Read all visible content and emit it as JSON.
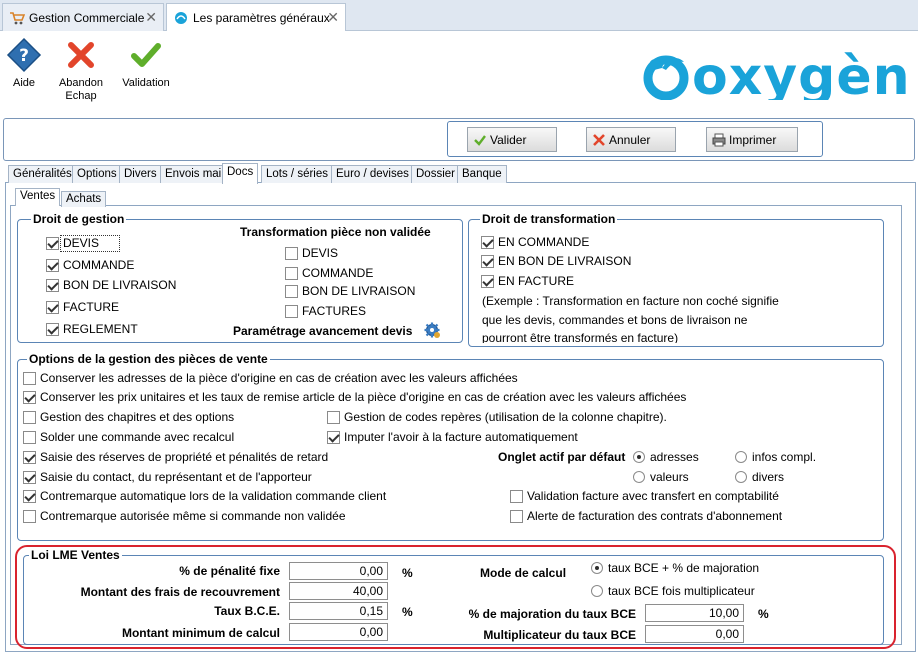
{
  "doc_tabs": [
    {
      "label": "Gestion Commerciale",
      "active": false
    },
    {
      "label": "Les paramètres généraux",
      "active": true
    }
  ],
  "toolbar": {
    "aide": "Aide",
    "abandon_line1": "Abandon",
    "abandon_line2": "Echap",
    "validation": "Validation"
  },
  "logo_text": "oxygène",
  "actions": {
    "valider": "Valider",
    "annuler": "Annuler",
    "imprimer": "Imprimer"
  },
  "settings_tabs": [
    "Généralités",
    "Options",
    "Divers",
    "Envois mail",
    "Docs",
    "Lots / séries",
    "Euro / devises",
    "Dossier",
    "Banque"
  ],
  "sub_tabs": [
    "Ventes",
    "Achats"
  ],
  "droit_gestion": {
    "title": "Droit de gestion",
    "items": [
      {
        "label": "DEVIS",
        "checked": true
      },
      {
        "label": "COMMANDE",
        "checked": true
      },
      {
        "label": "BON DE LIVRAISON",
        "checked": true
      },
      {
        "label": "FACTURE",
        "checked": true
      },
      {
        "label": "REGLEMENT",
        "checked": true
      }
    ],
    "transfo_title": "Transformation pièce non validée",
    "transfo_items": [
      {
        "label": "DEVIS",
        "checked": false
      },
      {
        "label": "COMMANDE",
        "checked": false
      },
      {
        "label": "BON DE LIVRAISON",
        "checked": false
      },
      {
        "label": "FACTURES",
        "checked": false
      }
    ],
    "avancement": "Paramétrage avancement devis"
  },
  "droit_transformation": {
    "title": "Droit de transformation",
    "items": [
      {
        "label": "EN COMMANDE",
        "checked": true
      },
      {
        "label": "EN BON DE LIVRAISON",
        "checked": true
      },
      {
        "label": "EN FACTURE",
        "checked": true
      }
    ],
    "note1": "(Exemple : Transformation en facture non coché signifie",
    "note2": "que les devis, commandes et bons de livraison ne",
    "note3": "pourront être transformés en facture)"
  },
  "options": {
    "title": "Options de la gestion des pièces de vente",
    "o1": {
      "label": "Conserver les adresses de la pièce d'origine en cas de création avec les valeurs affichées",
      "checked": false
    },
    "o2": {
      "label": "Conserver les prix unitaires et les taux de remise article de la pièce d'origine en cas de création avec les valeurs affichées",
      "checked": true
    },
    "o3": {
      "label": "Gestion des chapitres et des options",
      "checked": false
    },
    "o4": {
      "label": "Gestion de codes repères (utilisation de la colonne chapitre).",
      "checked": false
    },
    "o5": {
      "label": "Solder une commande avec recalcul",
      "checked": false
    },
    "o6": {
      "label": "Imputer l'avoir à la facture automatiquement",
      "checked": true
    },
    "o7": {
      "label": "Saisie des réserves de propriété et pénalités de retard",
      "checked": true
    },
    "o8": {
      "label": "Saisie du contact, du représentant et de l'apporteur",
      "checked": true
    },
    "o9": {
      "label": "Contremarque automatique lors de la validation commande client",
      "checked": true
    },
    "o10": {
      "label": "Contremarque autorisée même si commande non validée",
      "checked": false
    },
    "o11": {
      "label": "Validation facture avec transfert en comptabilité",
      "checked": false
    },
    "o12": {
      "label": "Alerte de facturation des contrats d'abonnement",
      "checked": false
    },
    "onglet_label": "Onglet actif par défaut",
    "onglet": [
      {
        "label": "adresses",
        "selected": true
      },
      {
        "label": "infos compl.",
        "selected": false
      },
      {
        "label": "valeurs",
        "selected": false
      },
      {
        "label": "divers",
        "selected": false
      }
    ]
  },
  "lme": {
    "title": "Loi LME Ventes",
    "penalite_label": "% de pénalité fixe",
    "penalite_value": "0,00",
    "frais_label": "Montant des frais de recouvrement",
    "frais_value": "40,00",
    "taux_label": "Taux B.C.E.",
    "taux_value": "0,15",
    "minimum_label": "Montant minimum de calcul",
    "minimum_value": "0,00",
    "percent": "%",
    "mode_label": "Mode de calcul",
    "mode_options": [
      {
        "label": "taux BCE + % de majoration",
        "selected": true
      },
      {
        "label": "taux BCE fois multiplicateur",
        "selected": false
      }
    ],
    "majoration_label": "% de majoration du taux BCE",
    "majoration_value": "10,00",
    "multiplicateur_label": "Multiplicateur du taux BCE",
    "multiplicateur_value": "0,00"
  },
  "colors": {
    "accent": "#1aa3d9",
    "red_frame": "#d9232e",
    "frame_blue": "#5b85b5"
  }
}
